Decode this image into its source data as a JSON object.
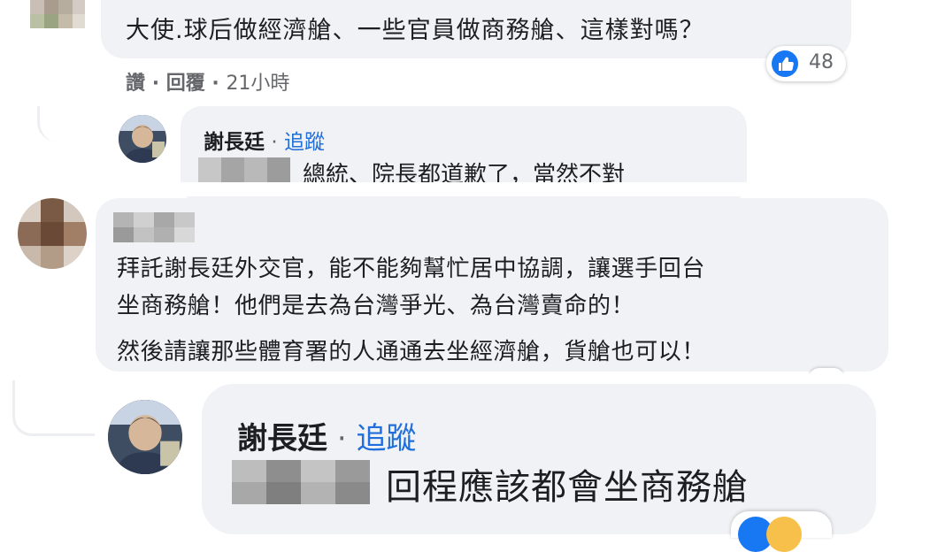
{
  "comment1": {
    "text": "大使.球后做經濟艙、一些官員做商務艙、這樣對嗎？",
    "actions": {
      "like": "讚",
      "reply": "回覆",
      "time": "21小時"
    },
    "reaction_count": "48",
    "reaction_icon": "like-icon"
  },
  "reply1": {
    "author": "謝長廷",
    "separator": "·",
    "follow": "追蹤",
    "text": "總統、院長都道歉了，當然不對"
  },
  "comment2": {
    "lines": [
      "拜託謝長廷外交官，能不能夠幫忙居中協調，讓選手回台",
      "坐商務艙！他們是去為台灣爭光、為台灣賣命的！",
      "然後請讓那些體育署的人通通去坐經濟艙，貨艙也可以！"
    ]
  },
  "reply2": {
    "author": "謝長廷",
    "separator": "·",
    "follow": "追蹤",
    "text": "回程應該都會坐商務艙"
  },
  "colors": {
    "bubble": "#f0f2f5",
    "link_blue": "#216fdb",
    "text": "#1c1e21",
    "meta": "#65676b"
  }
}
